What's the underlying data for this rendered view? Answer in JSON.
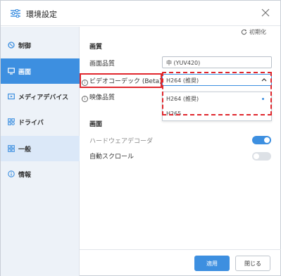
{
  "window": {
    "title": "環境設定",
    "app_icon": "sliders-icon",
    "close_icon": "close-icon"
  },
  "sidebar": {
    "items": [
      {
        "label": "制御",
        "icon": "control-icon"
      },
      {
        "label": "画面",
        "icon": "monitor-icon",
        "active": true
      },
      {
        "label": "メディアデバイス",
        "icon": "media-device-icon"
      },
      {
        "label": "ドライバ",
        "icon": "driver-icon"
      },
      {
        "label": "一般",
        "icon": "grid-icon"
      },
      {
        "label": "情報",
        "icon": "info-icon"
      }
    ]
  },
  "main": {
    "reset_label": "初期化",
    "section1_title": "画質",
    "image_quality_label": "画面品質",
    "image_quality_value": "中 (YUV420)",
    "codec_label": "ビデオコーデック (Beta)",
    "codec_value": "H264 (推奨)",
    "codec_options": [
      "H264 (推奨)",
      "H265"
    ],
    "video_quality_label": "映像品質",
    "section2_title": "画面",
    "hw_decoder_label": "ハードウェアデコーダ",
    "hw_decoder_on": true,
    "auto_scroll_label": "自動スクロール",
    "auto_scroll_on": false
  },
  "footer": {
    "apply_label": "適用",
    "close_label": "閉じる"
  },
  "colors": {
    "accent": "#3d8fe0",
    "annotation": "#e0272d",
    "sidebar_bg": "#edf2f8"
  }
}
